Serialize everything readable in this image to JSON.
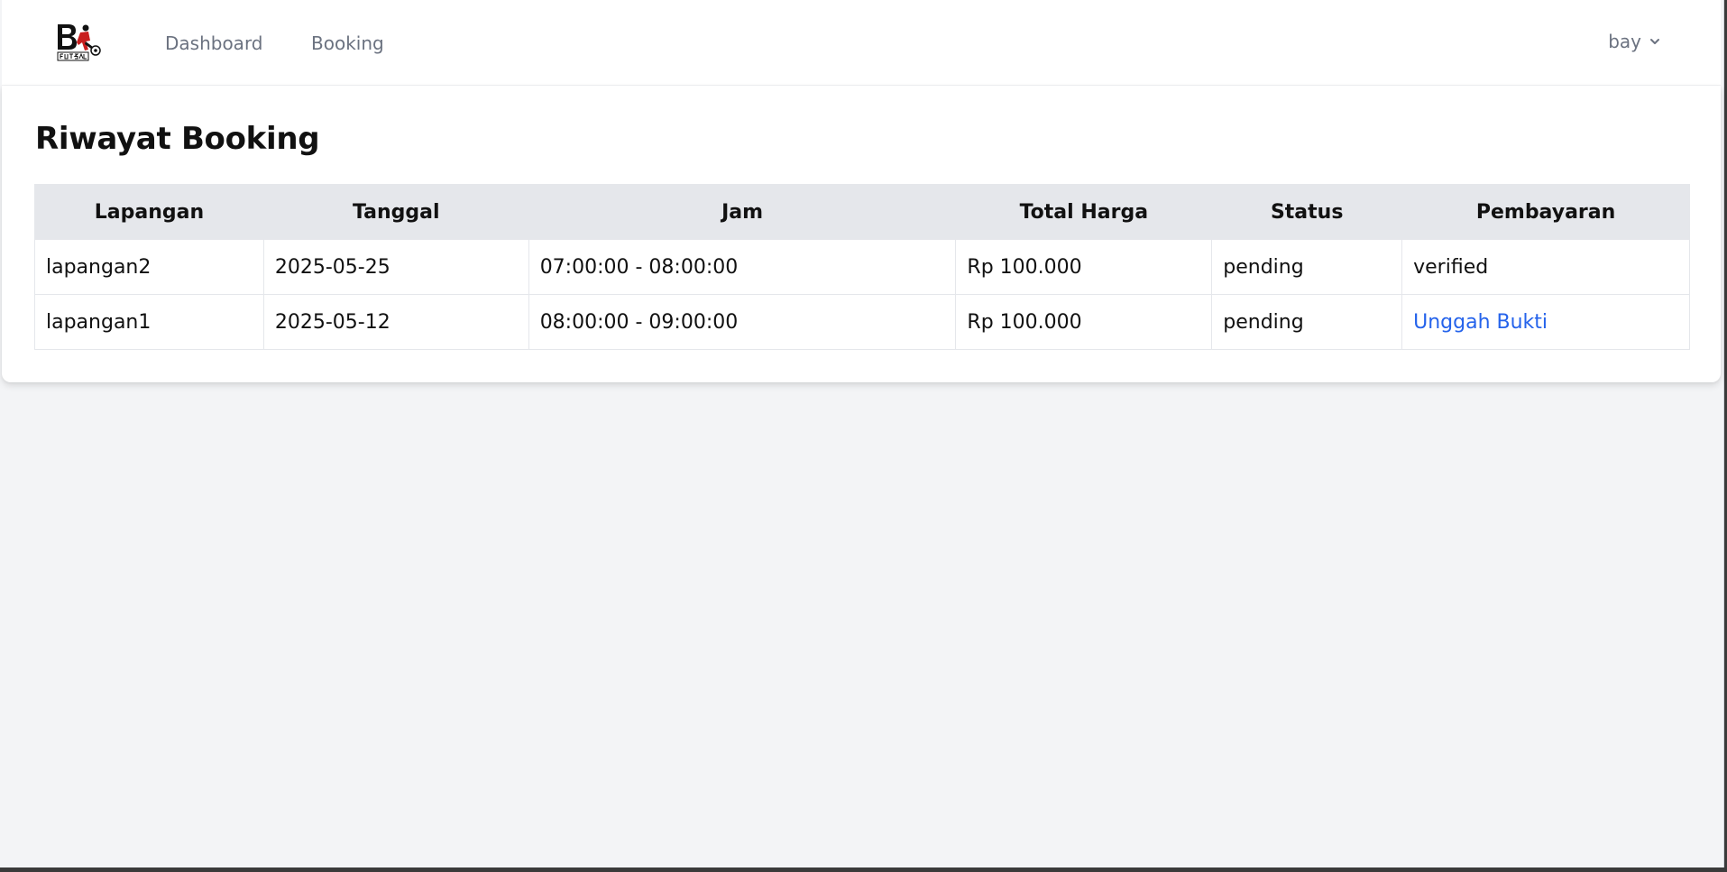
{
  "nav": {
    "logo_text": "BE FUTSAL",
    "links": [
      {
        "label": "Dashboard"
      },
      {
        "label": "Booking"
      }
    ],
    "user": {
      "name": "bay",
      "icon": "chevron-down-icon"
    }
  },
  "main": {
    "title": "Riwayat Booking",
    "table": {
      "headers": [
        "Lapangan",
        "Tanggal",
        "Jam",
        "Total Harga",
        "Status",
        "Pembayaran"
      ],
      "rows": [
        [
          "lapangan2",
          "2025-05-25",
          "07:00:00 - 08:00:00",
          "Rp 100.000",
          "pending",
          "verified"
        ],
        [
          "lapangan1",
          "2025-05-12",
          "08:00:00 - 09:00:00",
          "Rp 100.000",
          "pending",
          "Unggah Bukti"
        ]
      ]
    }
  },
  "colors": {
    "page_bg": "#f3f4f6",
    "header_bg": "#e5e7eb",
    "link": "#2563eb",
    "nav_text": "#6b7280"
  }
}
